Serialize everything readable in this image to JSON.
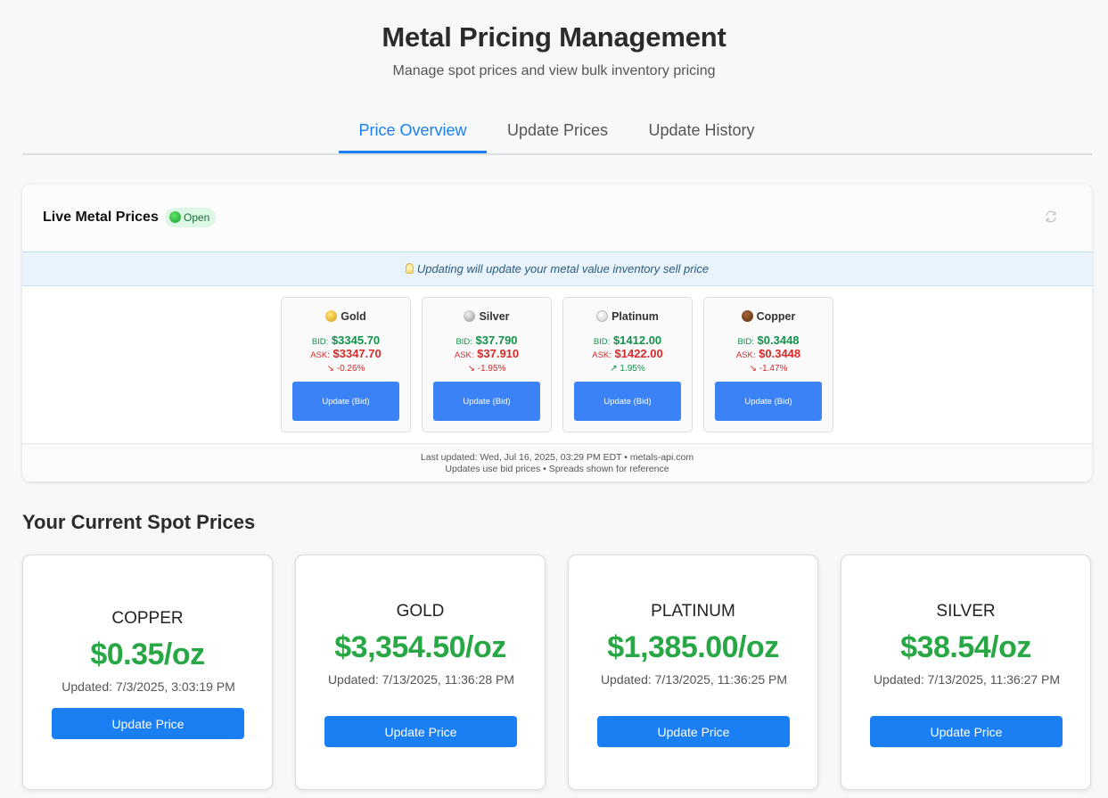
{
  "header": {
    "title": "Metal Pricing Management",
    "subtitle": "Manage spot prices and view bulk inventory pricing"
  },
  "tabs": [
    {
      "label": "Price Overview",
      "active": true
    },
    {
      "label": "Update Prices",
      "active": false
    },
    {
      "label": "Update History",
      "active": false
    }
  ],
  "live": {
    "title": "Live Metal Prices",
    "status": "Open",
    "refresh_icon": "refresh-icon",
    "notice": "Updating will update your metal value inventory sell price",
    "bid_label": "BID:",
    "ask_label": "ASK:",
    "metals": [
      {
        "name": "Gold",
        "icon": "gold-medal-icon",
        "bid": "$3345.70",
        "ask": "$3347.70",
        "change": "↘ -0.26%",
        "direction": "down",
        "button": "Update (Bid)"
      },
      {
        "name": "Silver",
        "icon": "silver-medal-icon",
        "bid": "$37.790",
        "ask": "$37.910",
        "change": "↘ -1.95%",
        "direction": "down",
        "button": "Update (Bid)"
      },
      {
        "name": "Platinum",
        "icon": "white-circle-icon",
        "bid": "$1412.00",
        "ask": "$1422.00",
        "change": "↗ 1.95%",
        "direction": "up",
        "button": "Update (Bid)"
      },
      {
        "name": "Copper",
        "icon": "brown-circle-icon",
        "bid": "$0.3448",
        "ask": "$0.3448",
        "change": "↘ -1.47%",
        "direction": "down",
        "button": "Update (Bid)"
      }
    ],
    "footer_line1": "Last updated: Wed, Jul 16, 2025, 03:29 PM EDT • metals-api.com",
    "footer_line2": "Updates use bid prices • Spreads shown for reference"
  },
  "spot": {
    "title": "Your Current Spot Prices",
    "cards": [
      {
        "name": "COPPER",
        "price": "$0.35/oz",
        "updated": "Updated: 7/3/2025, 3:03:19 PM",
        "button": "Update Price"
      },
      {
        "name": "GOLD",
        "price": "$3,354.50/oz",
        "updated": "Updated: 7/13/2025, 11:36:28 PM",
        "button": "Update Price"
      },
      {
        "name": "PLATINUM",
        "price": "$1,385.00/oz",
        "updated": "Updated: 7/13/2025, 11:36:25 PM",
        "button": "Update Price"
      },
      {
        "name": "SILVER",
        "price": "$38.54/oz",
        "updated": "Updated: 7/13/2025, 11:36:27 PM",
        "button": "Update Price"
      }
    ]
  },
  "colors": {
    "accent": "#1a7ff2",
    "bid": "#13924a",
    "ask": "#d42a2a",
    "spot_price": "#28a745"
  }
}
